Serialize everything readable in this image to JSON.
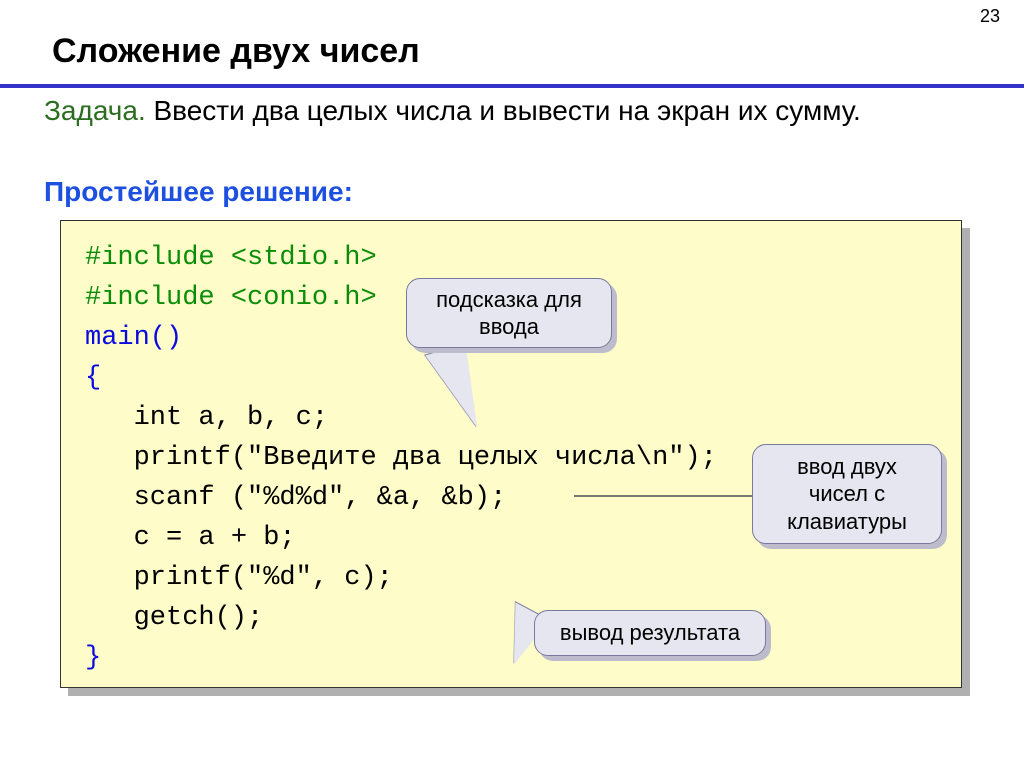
{
  "page_number": "23",
  "title": "Сложение двух чисел",
  "task": {
    "label": "Задача.",
    "text": " Ввести два целых числа и вывести на экран их сумму."
  },
  "solution_label": "Простейшее решение:",
  "code": {
    "l1a": "#include <stdio.h>",
    "l2a": "#include <conio.h>",
    "l3": "main()",
    "l4": "{",
    "l5": "   int a, b, c;",
    "l6": "   printf(\"Введите два целых числа\\n\");",
    "l7": "   scanf (\"%d%d\", &a, &b);",
    "l8": "   c = a + b;",
    "l9": "   printf(\"%d\", c);",
    "l10": "   getch();",
    "l11": "}"
  },
  "callouts": {
    "c1": "подсказка для ввода",
    "c2": "ввод двух чисел с клавиатуры",
    "c3": "вывод результата"
  }
}
